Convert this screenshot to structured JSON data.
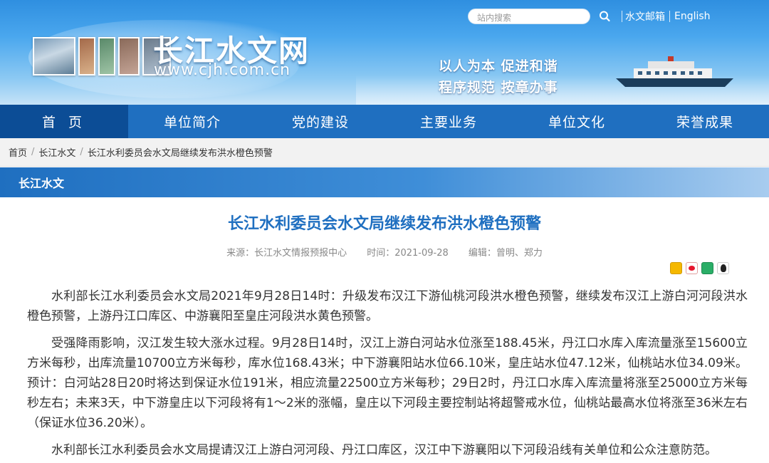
{
  "header": {
    "site_title": "长江水文网",
    "site_url": "www.cjh.com.cn",
    "slogan_line1": "以人为本  促进和谐",
    "slogan_line2": "程序规范  按章办事",
    "search_placeholder": "站内搜索",
    "links": [
      "水文邮箱",
      "English"
    ]
  },
  "nav": {
    "items": [
      "首 页",
      "单位简介",
      "党的建设",
      "主要业务",
      "单位文化",
      "荣誉成果"
    ],
    "active_index": 0
  },
  "breadcrumb": [
    "首页",
    "长江水文",
    "长江水利委员会水文局继续发布洪水橙色预警"
  ],
  "section": {
    "title": "长江水文"
  },
  "article": {
    "title": "长江水利委员会水文局继续发布洪水橙色预警",
    "source": "来源：长江水文情报预报中心",
    "time": "时间：2021-09-28",
    "editor": "编辑：曾明、郑力",
    "paragraphs": [
      "水利部长江水利委员会水文局2021年9月28日14时：升级发布汉江下游仙桃河段洪水橙色预警，继续发布汉江上游白河河段洪水橙色预警，上游丹江口库区、中游襄阳至皇庄河段洪水黄色预警。",
      "受强降雨影响，汉江发生较大涨水过程。9月28日14时，汉江上游白河站水位涨至188.45米，丹江口水库入库流量涨至15600立方米每秒，出库流量10700立方米每秒，库水位168.43米；中下游襄阳站水位66.10米，皇庄站水位47.12米，仙桃站水位34.09米。预计：白河站28日20时将达到保证水位191米，相应流量22500立方米每秒；29日2时，丹江口水库入库流量将涨至25000立方米每秒左右；未来3天，中下游皇庄以下河段将有1～2米的涨幅，皇庄以下河段主要控制站将超警戒水位，仙桃站最高水位将涨至36米左右（保证水位36.20米）。",
      "水利部长江水利委员会水文局提请汉江上游白河河段、丹江口库区，汉江中下游襄阳以下河段沿线有关单位和公众注意防范。"
    ]
  },
  "share_icons": [
    "qzone-icon",
    "weibo-icon",
    "wechat-icon",
    "qq-icon"
  ],
  "colors": {
    "nav_bg": "#1f6fc0",
    "nav_active": "#0c4d96",
    "title_blue": "#1f6fc0"
  }
}
